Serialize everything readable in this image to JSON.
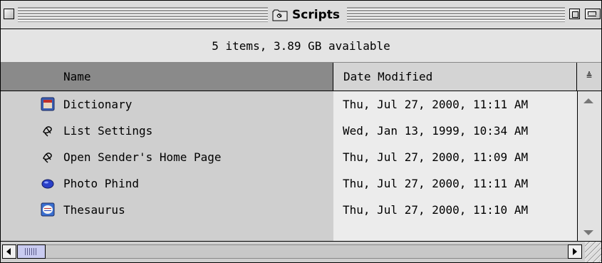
{
  "window": {
    "title": "Scripts",
    "info": "5 items, 3.89 GB available"
  },
  "columns": {
    "name_label": "Name",
    "date_label": "Date Modified",
    "sort_glyph": "≜"
  },
  "rows": [
    {
      "name": "Dictionary",
      "date": "Thu, Jul 27, 2000, 11:11 AM",
      "icon": "dictionary-app-icon"
    },
    {
      "name": "List Settings",
      "date": "Wed, Jan 13, 1999, 10:34 AM",
      "icon": "applescript-icon"
    },
    {
      "name": "Open Sender's Home Page",
      "date": "Thu, Jul 27, 2000, 11:09 AM",
      "icon": "applescript-icon"
    },
    {
      "name": "Photo Phind",
      "date": "Thu, Jul 27, 2000, 11:11 AM",
      "icon": "photo-phind-app-icon"
    },
    {
      "name": "Thesaurus",
      "date": "Thu, Jul 27, 2000, 11:10 AM",
      "icon": "thesaurus-app-icon"
    }
  ],
  "colors": {
    "selected_column_header": "#8a8a8a",
    "name_column_bg": "#cfcfcf",
    "date_column_bg": "#ececec",
    "scroll_thumb": "#c9cbf0"
  }
}
